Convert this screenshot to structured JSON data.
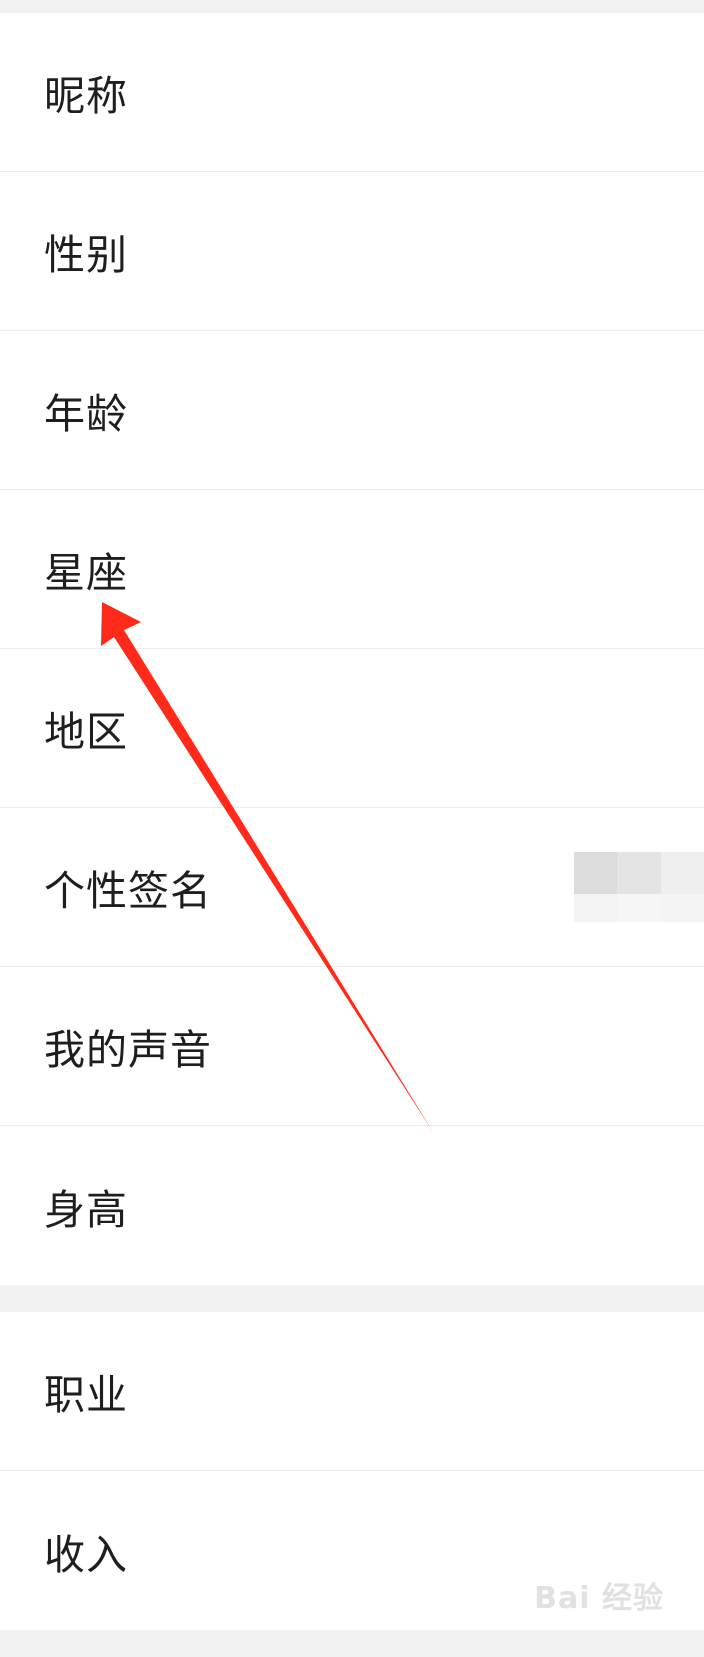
{
  "profile_fields": {
    "group1": [
      {
        "label": "昵称"
      },
      {
        "label": "性别"
      },
      {
        "label": "年龄"
      },
      {
        "label": "星座"
      },
      {
        "label": "地区"
      },
      {
        "label": "个性签名"
      },
      {
        "label": "我的声音"
      },
      {
        "label": "身高"
      }
    ],
    "group2": [
      {
        "label": "职业"
      },
      {
        "label": "收入"
      }
    ]
  },
  "annotation": {
    "arrow_color": "#ff2a1a",
    "points_to": "星座"
  },
  "watermark": {
    "text": "Bai 经验"
  },
  "colors": {
    "background": "#f2f2f2",
    "row_background": "#ffffff",
    "divider": "#ececec",
    "text": "#1e1e1e"
  }
}
